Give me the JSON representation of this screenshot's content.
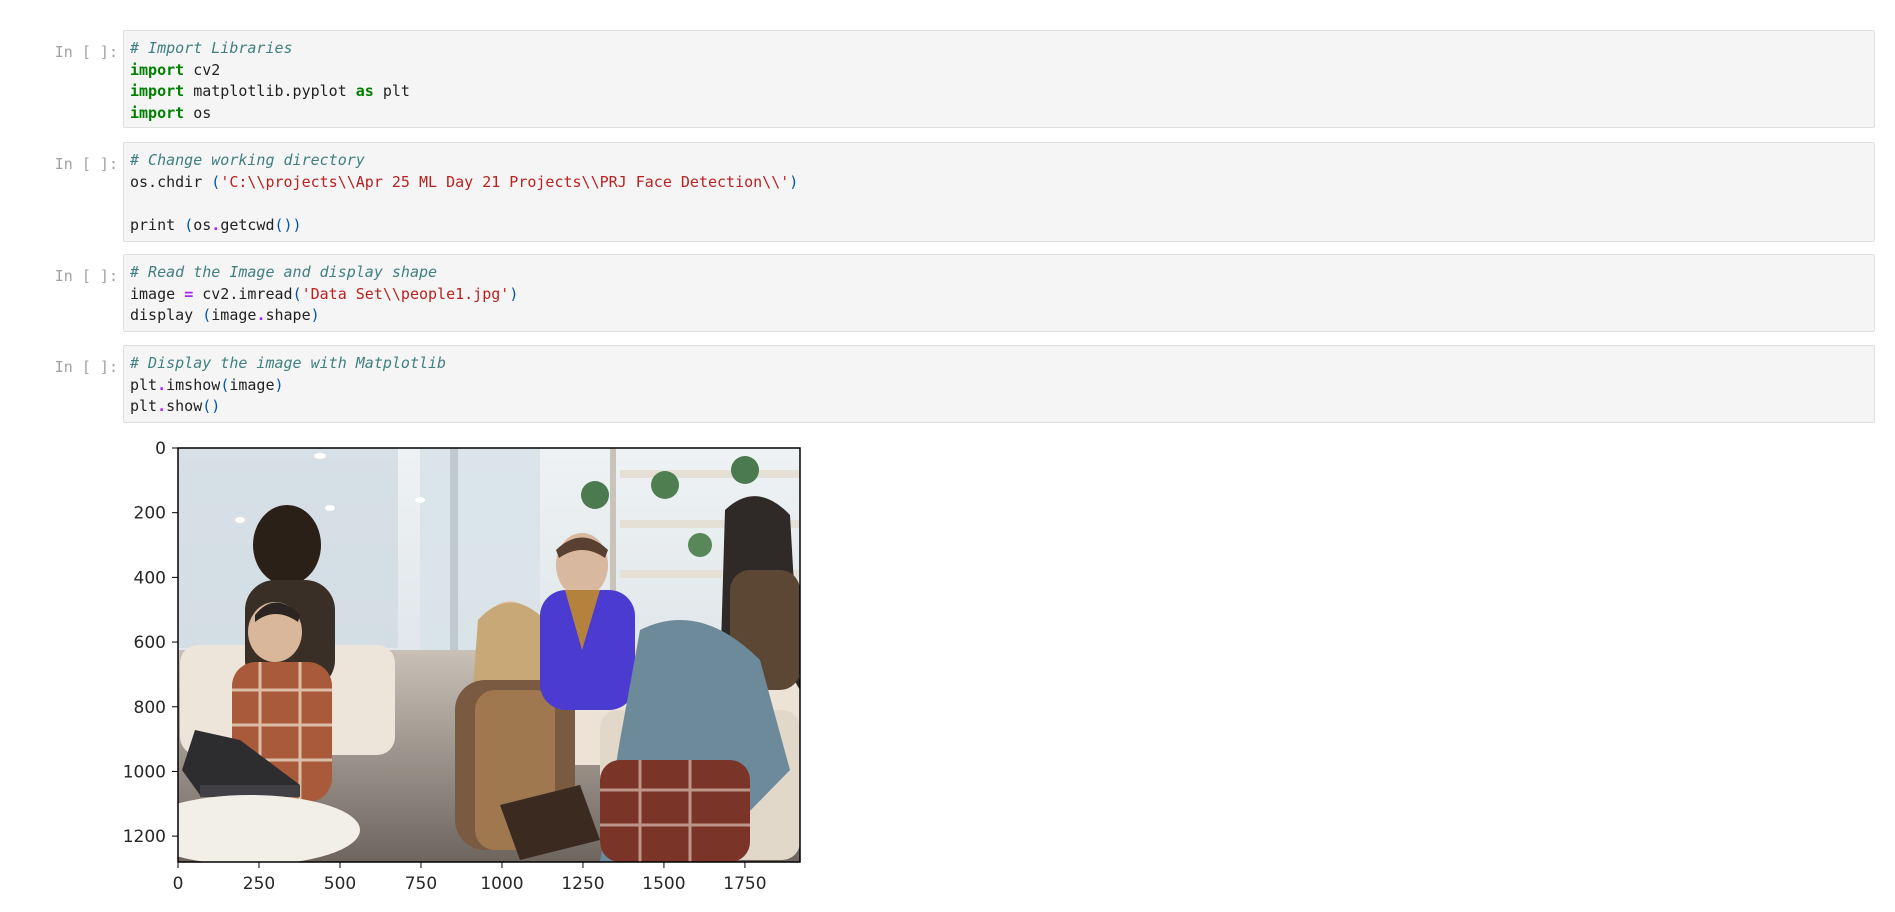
{
  "cells": [
    {
      "prompt": "In [ ]:",
      "lines": [
        [
          {
            "t": "# Import Libraries",
            "c": "comment"
          }
        ],
        [
          {
            "t": "import",
            "c": "kw"
          },
          {
            "t": " cv2",
            "c": "plain"
          }
        ],
        [
          {
            "t": "import",
            "c": "kw"
          },
          {
            "t": " matplotlib.pyplot ",
            "c": "plain"
          },
          {
            "t": "as",
            "c": "kw"
          },
          {
            "t": " plt",
            "c": "plain"
          }
        ],
        [
          {
            "t": "import",
            "c": "kw"
          },
          {
            "t": " os",
            "c": "plain"
          }
        ]
      ]
    },
    {
      "prompt": "In [ ]:",
      "lines": [
        [
          {
            "t": "# Change working directory",
            "c": "comment"
          }
        ],
        [
          {
            "t": "os.chdir ",
            "c": "plain"
          },
          {
            "t": "(",
            "c": "paren"
          },
          {
            "t": "'C:\\\\projects\\\\Apr 25 ML Day 21 Projects\\\\PRJ Face Detection\\\\'",
            "c": "str"
          },
          {
            "t": ")",
            "c": "paren"
          }
        ],
        [
          {
            "t": "",
            "c": "plain"
          }
        ],
        [
          {
            "t": "print ",
            "c": "plain"
          },
          {
            "t": "(",
            "c": "paren"
          },
          {
            "t": "os",
            "c": "plain"
          },
          {
            "t": ".",
            "c": "op"
          },
          {
            "t": "getcwd",
            "c": "plain"
          },
          {
            "t": "())",
            "c": "paren"
          }
        ]
      ]
    },
    {
      "prompt": "In [ ]:",
      "lines": [
        [
          {
            "t": "# Read the Image and display shape",
            "c": "comment"
          }
        ],
        [
          {
            "t": "image ",
            "c": "plain"
          },
          {
            "t": "=",
            "c": "op"
          },
          {
            "t": " cv2.imread",
            "c": "plain"
          },
          {
            "t": "(",
            "c": "paren"
          },
          {
            "t": "'Data Set\\\\people1.jpg'",
            "c": "str"
          },
          {
            "t": ")",
            "c": "paren"
          }
        ],
        [
          {
            "t": "display ",
            "c": "plain"
          },
          {
            "t": "(",
            "c": "paren"
          },
          {
            "t": "image",
            "c": "plain"
          },
          {
            "t": ".",
            "c": "op"
          },
          {
            "t": "shape",
            "c": "plain"
          },
          {
            "t": ")",
            "c": "paren"
          }
        ]
      ]
    },
    {
      "prompt": "In [ ]:",
      "lines": [
        [
          {
            "t": "# Display the image with Matplotlib",
            "c": "comment"
          }
        ],
        [
          {
            "t": "plt",
            "c": "plain"
          },
          {
            "t": ".",
            "c": "op"
          },
          {
            "t": "imshow",
            "c": "plain"
          },
          {
            "t": "(",
            "c": "paren"
          },
          {
            "t": "image",
            "c": "plain"
          },
          {
            "t": ")",
            "c": "paren"
          }
        ],
        [
          {
            "t": "plt",
            "c": "plain"
          },
          {
            "t": ".",
            "c": "op"
          },
          {
            "t": "show",
            "c": "plain"
          },
          {
            "t": "()",
            "c": "paren"
          }
        ]
      ]
    }
  ],
  "output_plot": {
    "y_ticks": [
      "0",
      "200",
      "400",
      "600",
      "800",
      "1000",
      "1200"
    ],
    "x_ticks": [
      "0",
      "250",
      "500",
      "750",
      "1000",
      "1250",
      "1500",
      "1750"
    ],
    "y_values": [
      0,
      200,
      400,
      600,
      800,
      1000,
      1200
    ],
    "x_values": [
      0,
      250,
      500,
      750,
      1000,
      1250,
      1500,
      1750
    ],
    "image_extent": {
      "width": 1920,
      "height": 1280
    },
    "colors": {
      "wall": "#dfe6ea",
      "floor": "#8a8078",
      "sofa": "#e8dfd3",
      "plaid": "#a85a3a",
      "blue_shirt": "#4b3bd0",
      "hair_blue": "#6c8a9a",
      "dark": "#2b2420"
    }
  }
}
